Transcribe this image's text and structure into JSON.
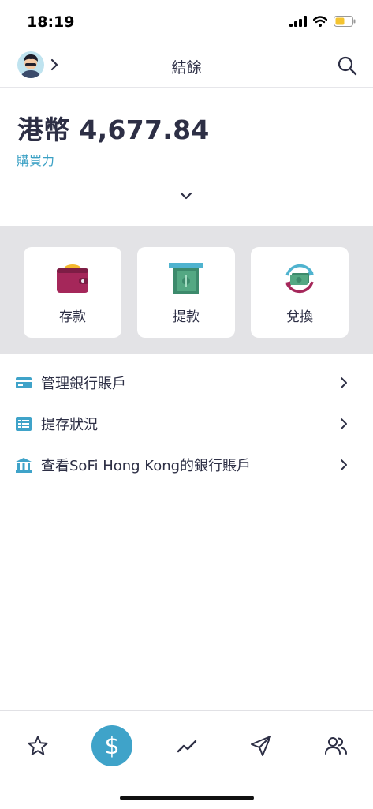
{
  "status": {
    "time": "18:19"
  },
  "header": {
    "title": "結餘"
  },
  "balance": {
    "text": "港幣 4,677.84",
    "caption": "購買力"
  },
  "actions": [
    {
      "label": "存款",
      "icon": "wallet-icon"
    },
    {
      "label": "提款",
      "icon": "cash-withdraw-icon"
    },
    {
      "label": "兌換",
      "icon": "currency-exchange-icon"
    }
  ],
  "menu": [
    {
      "label": "管理銀行賬戶",
      "icon": "credit-card-icon"
    },
    {
      "label": "提存狀況",
      "icon": "list-icon"
    },
    {
      "label": "查看SoFi Hong Kong的銀行賬戶",
      "icon": "bank-icon"
    }
  ],
  "tabs": [
    {
      "icon": "star-icon"
    },
    {
      "icon": "dollar-icon",
      "glyph": "$",
      "active": true
    },
    {
      "icon": "trend-icon"
    },
    {
      "icon": "send-icon"
    },
    {
      "icon": "people-icon"
    }
  ],
  "colors": {
    "accent": "#3fa3c9",
    "text": "#2d2f45",
    "panel": "#e3e3e6",
    "link": "#3aa0c4"
  }
}
